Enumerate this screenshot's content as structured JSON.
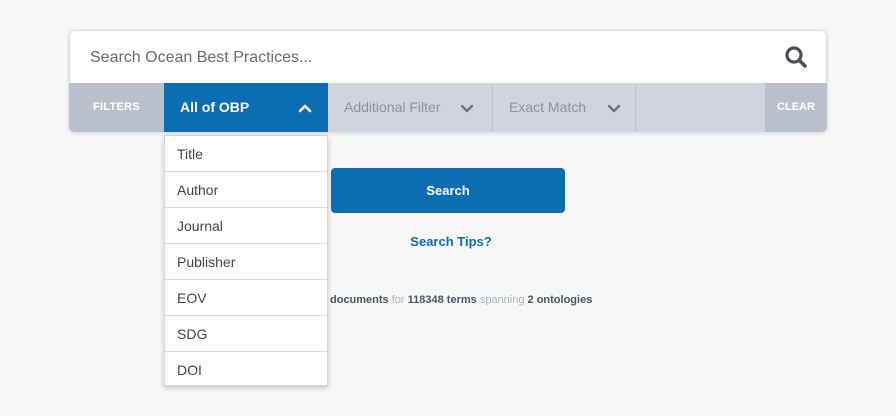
{
  "search": {
    "placeholder": "Search Ocean Best Practices..."
  },
  "filter_bar": {
    "filters_label": "FILTERS",
    "primary_filter": "All of OBP",
    "secondary_filters": [
      "Additional Filter",
      "Exact Match"
    ],
    "clear_label": "CLEAR"
  },
  "dropdown": {
    "items": [
      "Title",
      "Author",
      "Journal",
      "Publisher",
      "EOV",
      "SDG",
      "DOI"
    ]
  },
  "actions": {
    "search_button": "Search",
    "tips_link": "Search Tips?"
  },
  "stats": {
    "part1": "documents",
    "part2": " for ",
    "terms_count": "118348 terms",
    "part3": " spanning ",
    "ontologies": "2 ontologies"
  },
  "colors": {
    "accent": "#0d6db3",
    "filter_bar": "#d0d5dd",
    "filter_label_bg": "#b9c0cc",
    "background": "#f7f7f8"
  },
  "icons": {
    "search": "search-icon",
    "chevron": "chevron-down-icon",
    "chevron_up": "chevron-up-icon"
  }
}
